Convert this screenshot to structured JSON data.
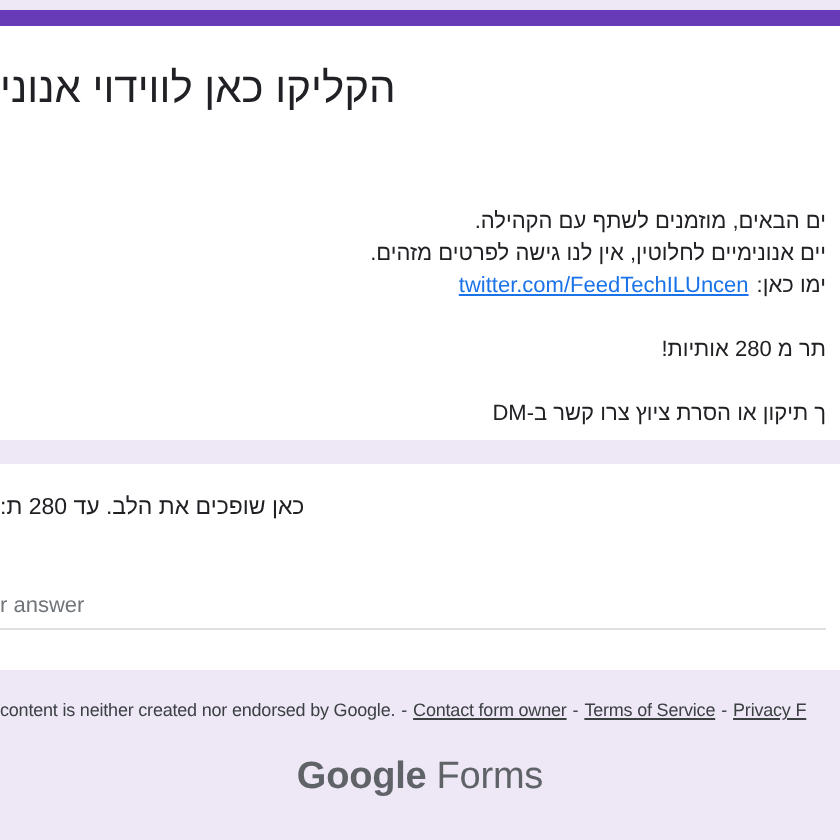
{
  "form": {
    "title": "הקליקו כאן לווידוי אנוני",
    "description": [
      {
        "kind": "text",
        "text": "ים הבאים, מוזמנים לשתף עם הקהילה."
      },
      {
        "kind": "text",
        "text": "יים אנונימיים לחלוטין, אין לנו גישה לפרטים מזהים."
      },
      {
        "kind": "link",
        "text": "ימו כאן:",
        "link": "twitter.com/FeedTechILUncen"
      },
      {
        "kind": "text",
        "text": "תר מ 280 אותיות!"
      },
      {
        "kind": "text",
        "text": "ך תיקון או הסרת ציוץ צרו קשר ב-DM"
      }
    ]
  },
  "question": {
    "label": ":כאן שופכים את הלב. עד 280 ת",
    "placeholder": "r answer"
  },
  "footer": {
    "disclaimer": "content is neither created nor endorsed by Google.",
    "contact_link": {
      "separator": "-",
      "text": "Contact form owner"
    },
    "terms_link": {
      "separator": "-",
      "text": "Terms of Service"
    },
    "privacy_link": {
      "separator": "-",
      "text": "Privacy F"
    },
    "brand": "Google",
    "product": "Forms"
  }
}
